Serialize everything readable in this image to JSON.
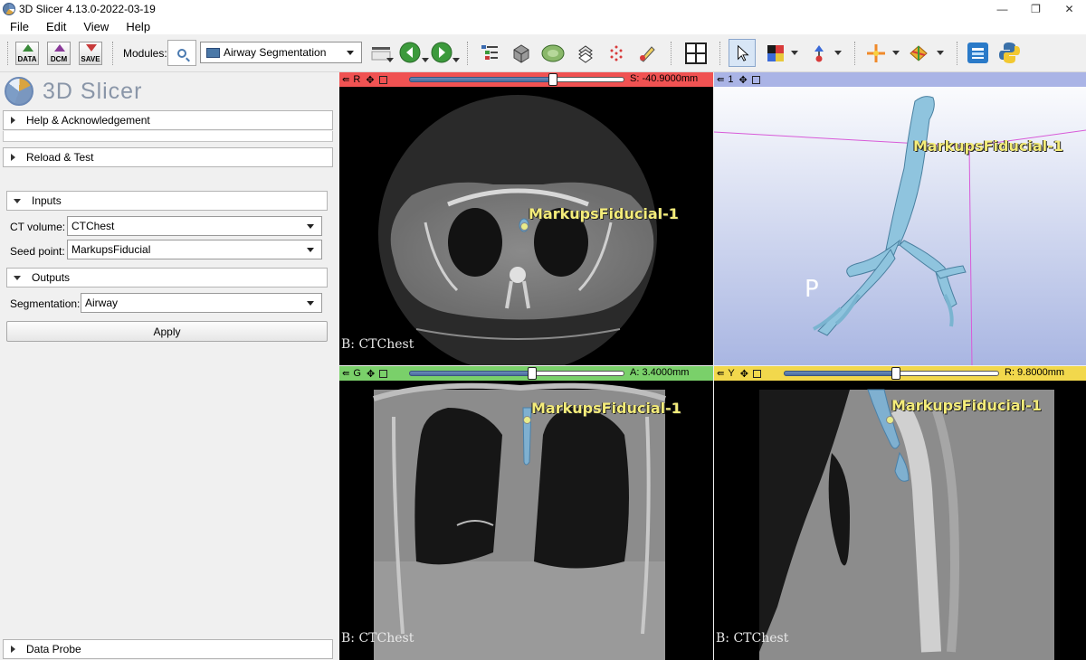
{
  "window": {
    "title": "3D Slicer 4.13.0-2022-03-19",
    "controls": [
      "—",
      "❐",
      "✕"
    ]
  },
  "menu": [
    "File",
    "Edit",
    "View",
    "Help"
  ],
  "toolbar": {
    "data_label": "DATA",
    "dcm_label": "DCM",
    "save_label": "SAVE",
    "modules_label": "Modules:",
    "module_selected": "Airway Segmentation"
  },
  "brand": {
    "name": "3D Slicer"
  },
  "sections": {
    "help": "Help & Acknowledgement",
    "reload": "Reload & Test",
    "inputs": "Inputs",
    "outputs": "Outputs",
    "data_probe": "Data Probe"
  },
  "form": {
    "ct_volume_label": "CT volume:",
    "ct_volume_value": "CTChest",
    "seed_point_label": "Seed point:",
    "seed_point_value": "MarkupsFiducial",
    "segmentation_label": "Segmentation:",
    "segmentation_value": "Airway",
    "apply_label": "Apply"
  },
  "views": {
    "red": {
      "name": "R",
      "offset": "S: -40.9000mm",
      "caption": "B: CTChest",
      "color": "#f05252",
      "slider": 0.67
    },
    "threeD": {
      "name": "1",
      "orientation_label": "P",
      "color": "#aab4e6"
    },
    "green": {
      "name": "G",
      "offset": "A: 3.4000mm",
      "caption": "B: CTChest",
      "color": "#7ad06a",
      "slider": 0.57
    },
    "yellow": {
      "name": "Y",
      "offset": "R: 9.8000mm",
      "caption": "B: CTChest",
      "color": "#f2d84c",
      "slider": 0.52
    }
  },
  "fiducial": {
    "label": "MarkupsFiducial-1"
  }
}
